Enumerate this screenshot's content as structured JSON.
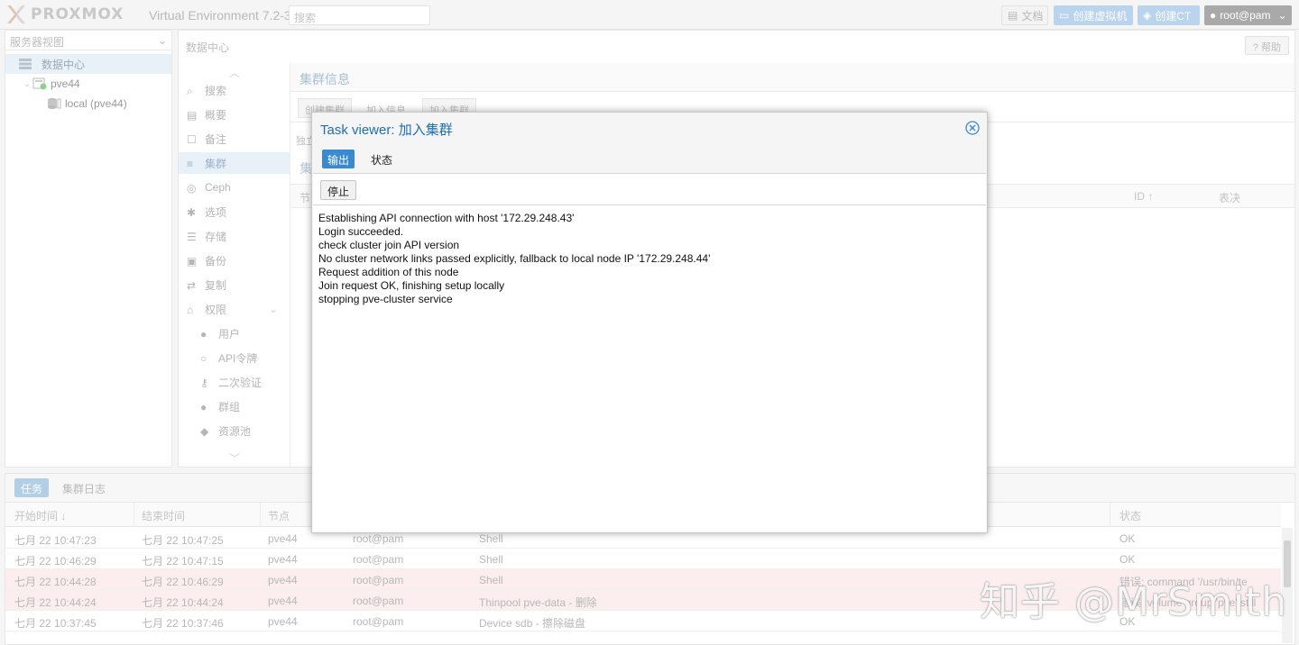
{
  "header": {
    "logo_text": "PROXMOX",
    "version_text": "Virtual Environment 7.2-3",
    "search_placeholder": "搜索",
    "docs_label": "文档",
    "create_vm_label": "创建虚拟机",
    "create_ct_label": "创建CT",
    "user_label": "root@pam"
  },
  "tree": {
    "view_select": "服务器视图",
    "items": [
      {
        "label": "数据中心"
      },
      {
        "label": "pve44"
      },
      {
        "label": "local (pve44)"
      }
    ]
  },
  "center": {
    "breadcrumb": "数据中心",
    "help_label": "帮助",
    "menu": [
      {
        "label": "搜索",
        "icon": "search-icon"
      },
      {
        "label": "概要",
        "icon": "book-icon"
      },
      {
        "label": "备注",
        "icon": "note-icon"
      },
      {
        "label": "集群",
        "icon": "server-icon"
      },
      {
        "label": "Ceph",
        "icon": "ceph-icon"
      },
      {
        "label": "选项",
        "icon": "gear-icon"
      },
      {
        "label": "存储",
        "icon": "database-icon"
      },
      {
        "label": "备份",
        "icon": "floppy-icon"
      },
      {
        "label": "复制",
        "icon": "retweet-icon"
      },
      {
        "label": "权限",
        "icon": "unlock-icon"
      },
      {
        "label": "用户",
        "icon": "user-icon"
      },
      {
        "label": "API令牌",
        "icon": "user-outline-icon"
      },
      {
        "label": "二次验证",
        "icon": "key-icon"
      },
      {
        "label": "群组",
        "icon": "users-icon"
      },
      {
        "label": "资源池",
        "icon": "tags-icon"
      }
    ],
    "cluster_info_title": "集群信息",
    "create_cluster_label": "创建集群",
    "join_info_label": "加入信息",
    "join_cluster_label": "加入集群",
    "standalone_text": "独立",
    "nodes_title": "集",
    "grid_head_node": "节",
    "grid_head_id": "ID ↑",
    "grid_head_vote": "表决"
  },
  "bottom": {
    "tab_tasks": "任务",
    "tab_cluster_log": "集群日志",
    "columns": {
      "start": "开始时间 ↓",
      "end": "结束时间",
      "node": "节点",
      "user": "",
      "desc": "",
      "status": "状态"
    },
    "rows": [
      {
        "start": "七月 22 10:47:23",
        "end": "七月 22 10:47:25",
        "node": "pve44",
        "user": "root@pam",
        "desc": "Shell",
        "status": "OK",
        "error": false
      },
      {
        "start": "七月 22 10:46:29",
        "end": "七月 22 10:47:15",
        "node": "pve44",
        "user": "root@pam",
        "desc": "Shell",
        "status": "OK",
        "error": false
      },
      {
        "start": "七月 22 10:44:28",
        "end": "七月 22 10:46:29",
        "node": "pve44",
        "user": "root@pam",
        "desc": "Shell",
        "status": "错误: command '/usr/bin/te",
        "error": true
      },
      {
        "start": "七月 22 10:44:24",
        "end": "七月 22 10:44:24",
        "node": "pve44",
        "user": "root@pam",
        "desc": "Thinpool pve-data - 删除",
        "status": "错误: volume group 'pve' still",
        "error": true
      },
      {
        "start": "七月 22 10:37:45",
        "end": "七月 22 10:37:46",
        "node": "pve44",
        "user": "root@pam",
        "desc": "Device sdb - 擦除磁盘",
        "status": "OK",
        "error": false
      }
    ]
  },
  "modal": {
    "title": "Task viewer: 加入集群",
    "tab_output": "输出",
    "tab_status": "状态",
    "stop_label": "停止",
    "log_lines": [
      "Establishing API connection with host '172.29.248.43'",
      "Login succeeded.",
      "check cluster join API version",
      "No cluster network links passed explicitly, fallback to local node IP '172.29.248.44'",
      "Request addition of this node",
      "Join request OK, finishing setup locally",
      "stopping pve-cluster service"
    ]
  },
  "watermark": "知乎 @MrSmith",
  "colors": {
    "accent": "#3a8ad1",
    "title_blue": "#1c6fb4",
    "error_row": "#fceeee"
  }
}
